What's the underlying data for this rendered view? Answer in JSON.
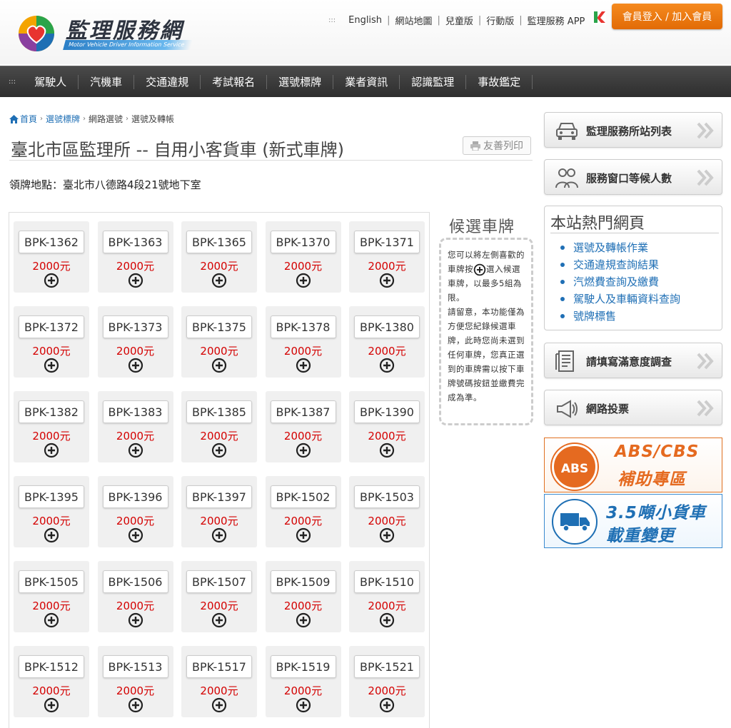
{
  "header": {
    "logo_text": "監理服務網",
    "logo_subtitle": "Motor Vehicle Driver Information Service",
    "top_links": [
      "English",
      "網站地圖",
      "兒童版",
      "行動版",
      "監理服務 APP"
    ],
    "member_button": "會員登入 / 加入會員"
  },
  "nav": {
    "items": [
      "駕駛人",
      "汽機車",
      "交通違規",
      "考試報名",
      "選號標牌",
      "業者資訊",
      "認識監理",
      "事故鑑定"
    ]
  },
  "breadcrumb": {
    "home": "首頁",
    "items": [
      "選號標牌",
      "網路選號",
      "選號及轉帳"
    ]
  },
  "page": {
    "title": "臺北市區監理所 -- 自用小客貨車 (新式車牌)",
    "print_label": "友善列印",
    "pickup_location": "領牌地點：臺北市八德路4段21號地下室"
  },
  "plates": [
    {
      "number": "BPK-1362",
      "price": "2000元"
    },
    {
      "number": "BPK-1363",
      "price": "2000元"
    },
    {
      "number": "BPK-1365",
      "price": "2000元"
    },
    {
      "number": "BPK-1370",
      "price": "2000元"
    },
    {
      "number": "BPK-1371",
      "price": "2000元"
    },
    {
      "number": "BPK-1372",
      "price": "2000元"
    },
    {
      "number": "BPK-1373",
      "price": "2000元"
    },
    {
      "number": "BPK-1375",
      "price": "2000元"
    },
    {
      "number": "BPK-1378",
      "price": "2000元"
    },
    {
      "number": "BPK-1380",
      "price": "2000元"
    },
    {
      "number": "BPK-1382",
      "price": "2000元"
    },
    {
      "number": "BPK-1383",
      "price": "2000元"
    },
    {
      "number": "BPK-1385",
      "price": "2000元"
    },
    {
      "number": "BPK-1387",
      "price": "2000元"
    },
    {
      "number": "BPK-1390",
      "price": "2000元"
    },
    {
      "number": "BPK-1395",
      "price": "2000元"
    },
    {
      "number": "BPK-1396",
      "price": "2000元"
    },
    {
      "number": "BPK-1397",
      "price": "2000元"
    },
    {
      "number": "BPK-1502",
      "price": "2000元"
    },
    {
      "number": "BPK-1503",
      "price": "2000元"
    },
    {
      "number": "BPK-1505",
      "price": "2000元"
    },
    {
      "number": "BPK-1506",
      "price": "2000元"
    },
    {
      "number": "BPK-1507",
      "price": "2000元"
    },
    {
      "number": "BPK-1509",
      "price": "2000元"
    },
    {
      "number": "BPK-1510",
      "price": "2000元"
    },
    {
      "number": "BPK-1512",
      "price": "2000元"
    },
    {
      "number": "BPK-1513",
      "price": "2000元"
    },
    {
      "number": "BPK-1517",
      "price": "2000元"
    },
    {
      "number": "BPK-1519",
      "price": "2000元"
    },
    {
      "number": "BPK-1521",
      "price": "2000元"
    }
  ],
  "candidates": {
    "title": "候選車牌",
    "text_before": "您可以將左側喜歡的車牌按",
    "text_after": "選入候選車牌，以最多5組為限。",
    "note": "請留意，本功能僅為方便您紀錄候選車牌，此時您尚未選到任何車牌，您真正選到的車牌需以按下車牌號碼按鈕並繳費完成為準。"
  },
  "sidebar": {
    "station_list": "監理服務所站列表",
    "queue": "服務窗口等候人數",
    "hot_title": "本站熱門網頁",
    "hot_links": [
      "選號及轉帳作業",
      "交通違規查詢結果",
      "汽燃費查詢及繳費",
      "駕駛人及車輛資料查詢",
      "號牌標售"
    ],
    "survey": "請填寫滿意度調查",
    "vote": "網路投票",
    "abs_badge": "ABS",
    "abs_line1": "ABS/CBS",
    "abs_line2": "補助專區",
    "truck_line1": "3.5噸小貨車",
    "truck_line2": "載重變更"
  },
  "colors": {
    "accent_orange": "#e56a20",
    "price_red": "#d40000",
    "link_blue": "#1f6fb5",
    "nav_dark": "#333333"
  }
}
